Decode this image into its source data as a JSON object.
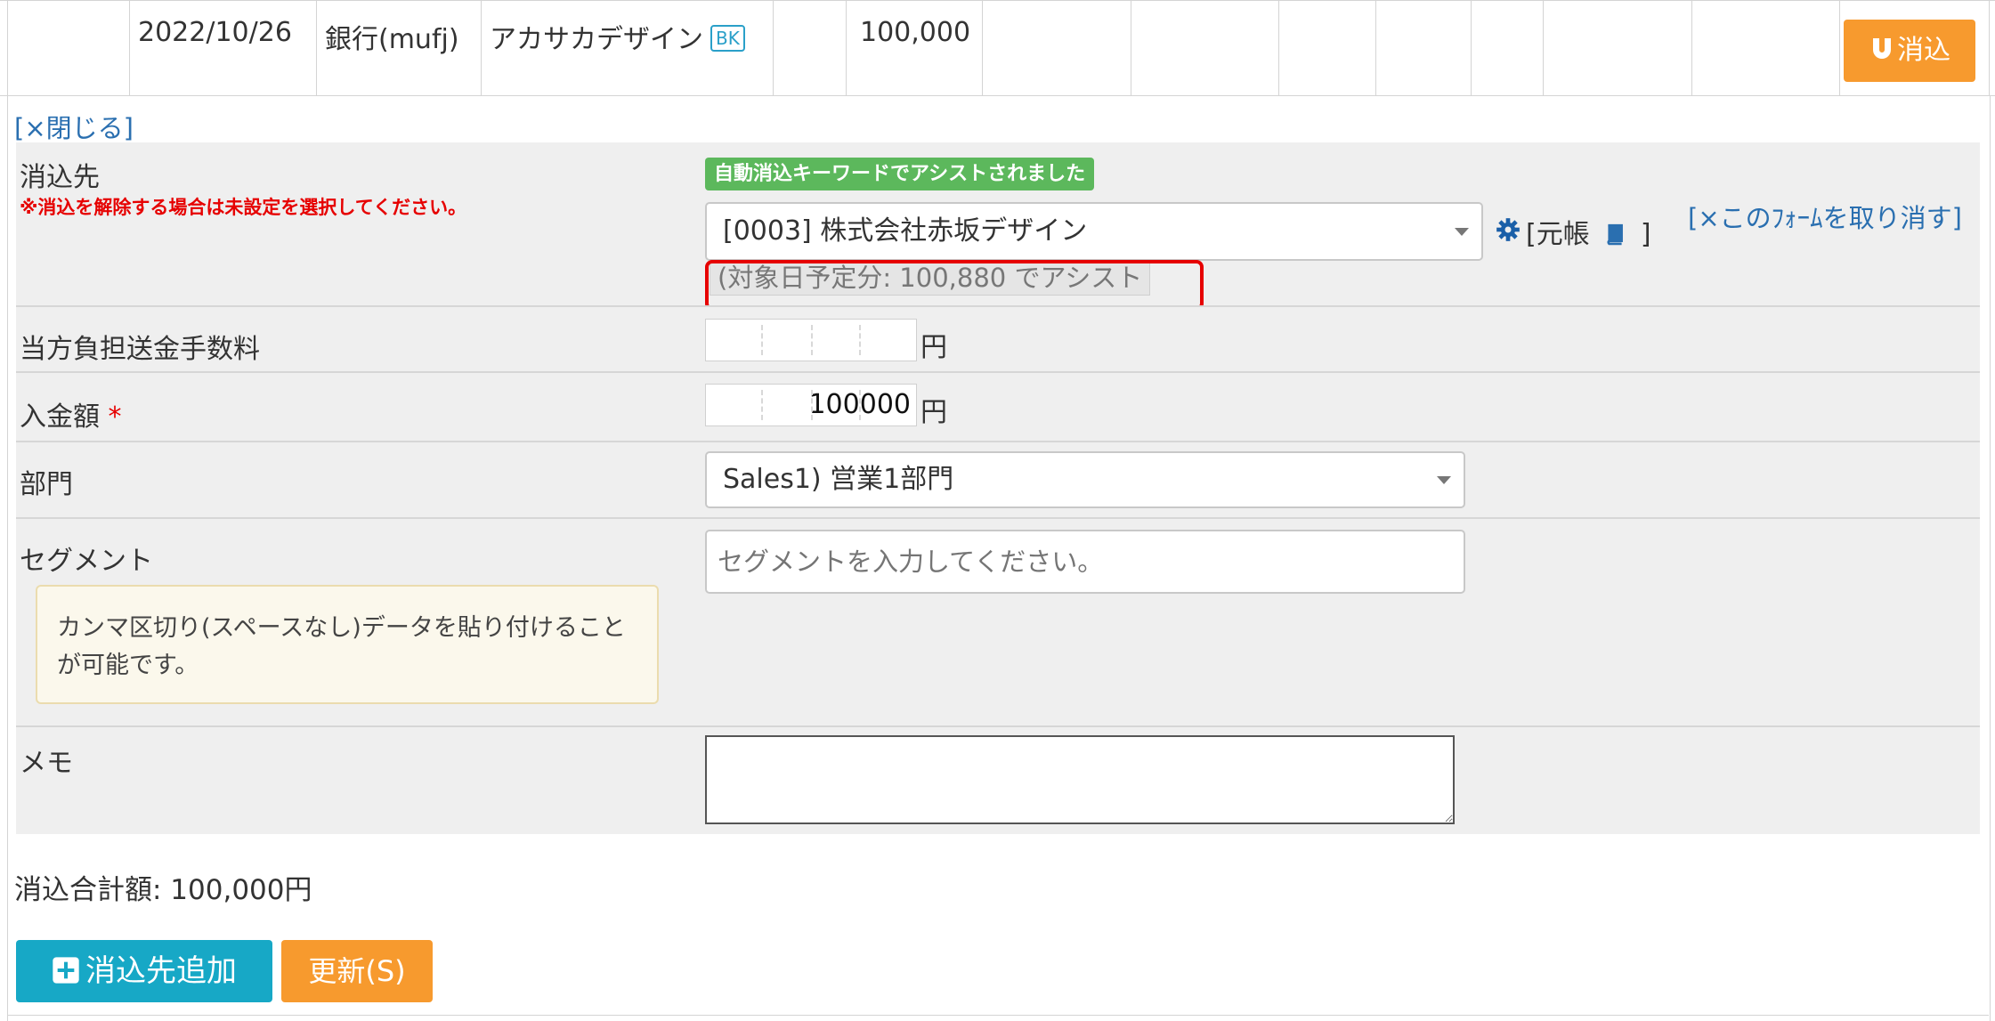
{
  "top_row": {
    "date": "2022/10/26",
    "account": "銀行(mufj)",
    "description": "アカサカデザイン",
    "badge": "BK",
    "amount": "100,000",
    "match_button": "消込",
    "match_icon": "u-icon"
  },
  "form": {
    "close_link": "[×閉じる]",
    "destination": {
      "label": "消込先",
      "note": "※消込を解除する場合は未設定を選択してください。",
      "assist_badge": "自動消込キーワードでアシストされました",
      "selected": "[0003] 株式会社赤坂デザイン",
      "ledger_open": "[元帳",
      "ledger_close": "]",
      "cancel_form": "[×このﾌｫｰﾑを取り消す]",
      "assist_note": "(対象日予定分: 100,880 でアシスト",
      "gear_icon": "gear-icon",
      "book_icon": "book-icon"
    },
    "fee": {
      "label": "当方負担送金手数料",
      "value": "",
      "unit": "円"
    },
    "deposit": {
      "label": "入金額",
      "required_mark": "*",
      "value": "100000",
      "unit": "円"
    },
    "department": {
      "label": "部門",
      "selected": "Sales1) 営業1部門"
    },
    "segment": {
      "label": "セグメント",
      "placeholder": "セグメントを入力してください。",
      "help": "カンマ区切り(スペースなし)データを貼り付けることが可能です。"
    },
    "memo": {
      "label": "メモ",
      "value": ""
    },
    "total": "消込合計額: 100,000円",
    "add_button": "消込先追加",
    "update_button": "更新(S)",
    "colors": {
      "orange": "#f79a2e",
      "teal": "#17a8c6",
      "green": "#5cb85c",
      "red": "#e60000",
      "link": "#2a6fb0"
    }
  }
}
